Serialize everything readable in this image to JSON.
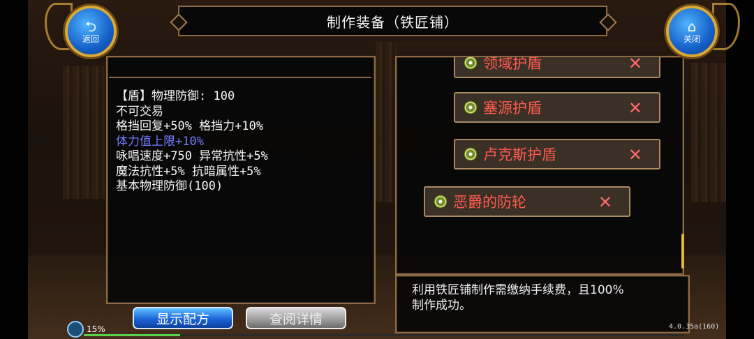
{
  "window": {
    "title": "制作装备（铁匠铺）"
  },
  "nav": {
    "back": {
      "label": "返回",
      "icon": "back-arrow-icon"
    },
    "close": {
      "label": "关闭",
      "icon": "home-icon"
    }
  },
  "item_stats": [
    {
      "text": "【盾】物理防御: 100",
      "highlight": false
    },
    {
      "text": "不可交易",
      "highlight": false
    },
    {
      "text": "格挡回复+50% 格挡力+10%",
      "highlight": false
    },
    {
      "text": "体力值上限+10%",
      "highlight": true
    },
    {
      "text": "咏唱速度+750 异常抗性+5%",
      "highlight": false
    },
    {
      "text": "魔法抗性+5% 抗暗属性+5%",
      "highlight": false
    },
    {
      "text": "基本物理防御(100)",
      "highlight": false
    }
  ],
  "equipment_list": [
    {
      "name": "领域护盾",
      "mark": "✕"
    },
    {
      "name": "塞源护盾",
      "mark": "✕"
    },
    {
      "name": "卢克斯护盾",
      "mark": "✕"
    },
    {
      "name": "恶爵的防轮",
      "mark": "✕"
    }
  ],
  "description": {
    "line1": "利用铁匠铺制作需缴纳手续费，且100%",
    "line2": "制作成功。"
  },
  "buttons": {
    "show_recipe": "显示配方",
    "view_details": "查阅详情"
  },
  "status": {
    "signal": "15%",
    "progress_fraction": 0.16,
    "version": "4.0.35a(160)"
  },
  "colors": {
    "accent_blue": "#1b64d8",
    "item_name_red": "#ff5a4e",
    "highlight_stat": "#6f7dff",
    "frame_gold": "#8c6a45"
  }
}
